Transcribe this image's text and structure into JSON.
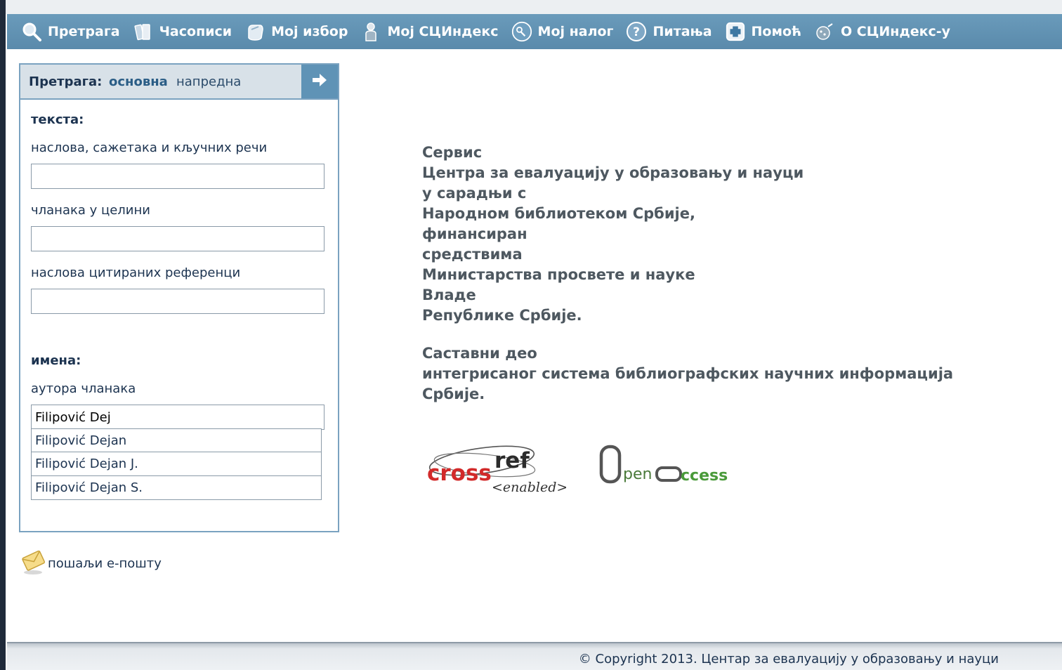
{
  "nav": {
    "items": [
      {
        "label": "Претрага",
        "icon": "search-icon"
      },
      {
        "label": "Часописи",
        "icon": "journals-icon"
      },
      {
        "label": "Мој избор",
        "icon": "my-selection-icon"
      },
      {
        "label": "Мој СЦИндекс",
        "icon": "user-icon"
      },
      {
        "label": "Мој налог",
        "icon": "account-icon"
      },
      {
        "label": "Питања",
        "icon": "question-icon"
      },
      {
        "label": "Помоћ",
        "icon": "help-icon"
      },
      {
        "label": "О СЦИндекс-у",
        "icon": "about-icon"
      }
    ]
  },
  "search": {
    "title": "Претрага:",
    "mode_basic": "основна",
    "mode_advanced": "напредна",
    "text_heading": "текста:",
    "field_titles_label": "наслова, сажетака и кључних речи",
    "field_titles_value": "",
    "field_fulltext_label": "чланака у целини",
    "field_fulltext_value": "",
    "field_refs_label": "наслова цитираних референци",
    "field_refs_value": "",
    "names_heading": "имена:",
    "field_author_label": "аутора чланака",
    "field_author_value": "Filipović Dej",
    "suggestions": [
      "Filipović Dejan",
      "Filipović Dejan J.",
      "Filipović Dejan S."
    ]
  },
  "email": {
    "label": "пошаљи е-пошту"
  },
  "info": {
    "lines1": [
      "Сервис",
      "Центра за евалуацију у образовању и науци",
      "у сарадњи с",
      "Народном библиотеком Србије,",
      "финансиран",
      "средствима",
      "Министарства просвете и науке",
      "Владе",
      "Републике Србије."
    ],
    "lines2": [
      "Саставни део",
      "интегрисаног система библиографских научних информација",
      "Србије."
    ]
  },
  "logos": {
    "crossref_main_a": "cross",
    "crossref_main_b": "ref",
    "crossref_sub": "<enabled>",
    "openaccess_a": "pen",
    "openaccess_b": "ccess"
  },
  "footer": {
    "copyright": "© Copyright 2013. Центар за евалуацију у образовању и науци"
  },
  "colors": {
    "nav_bg": "#5f93b6",
    "accent": "#2a5d86",
    "crossref_red": "#d22a2a",
    "openaccess_green": "#3a8a3a"
  }
}
